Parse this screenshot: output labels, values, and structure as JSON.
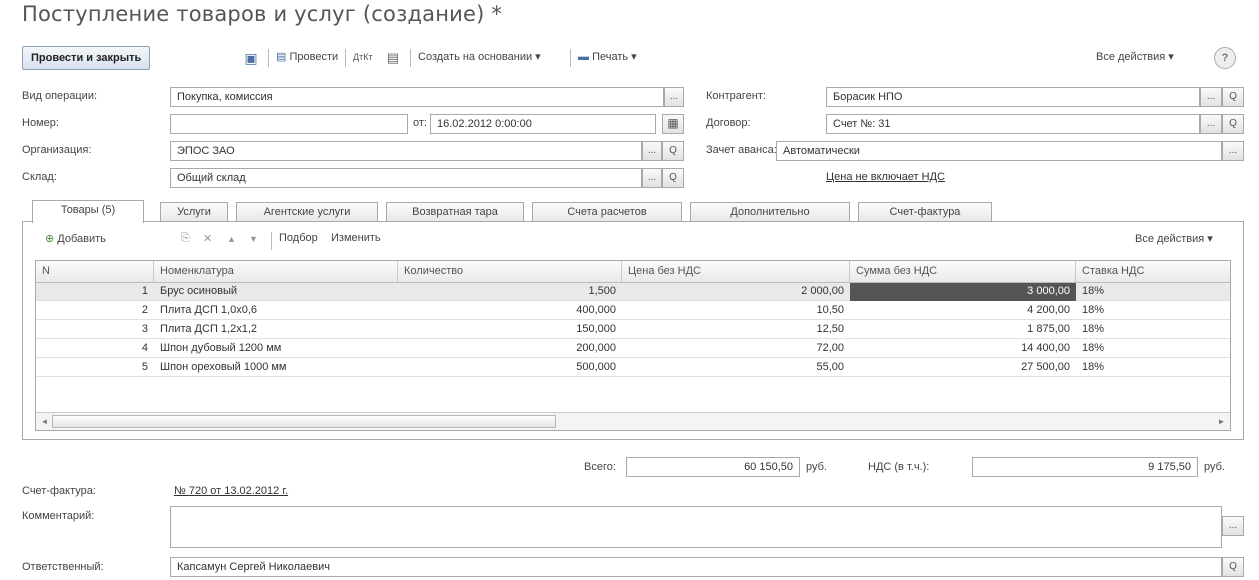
{
  "window": {
    "title": "Поступление товаров и услуг (создание) *"
  },
  "toolbar": {
    "post_close": "Провести и закрыть",
    "save_glyph": "▣",
    "post": "Провести",
    "dt_glyph": "ДтКт",
    "doc_glyph": "▤",
    "create_based": "Создать на основании ▾",
    "print": "Печать ▾",
    "all_actions": "Все действия ▾",
    "help": "?"
  },
  "form": {
    "op_label": "Вид операции:",
    "op_value": "Покупка, комиссия",
    "num_label": "Номер:",
    "num_value": "",
    "date_label": "от:",
    "date_value": "16.02.2012  0:00:00",
    "org_label": "Организация:",
    "org_value": "ЭПОС ЗАО",
    "wh_label": "Склад:",
    "wh_value": "Общий склад",
    "cp_label": "Контрагент:",
    "cp_value": "Борасик НПО",
    "contract_label": "Договор:",
    "contract_value": "Счет №: 31",
    "advance_label": "Зачет аванса:",
    "advance_value": "Автоматически",
    "price_link": "Цена не включает НДС",
    "ellipsis": "...",
    "search": "Q",
    "calendar": "▦"
  },
  "tabs": [
    "Товары (5)",
    "Услуги",
    "Агентские услуги",
    "Возвратная тара",
    "Счета расчетов",
    "Дополнительно",
    "Счет-фактура"
  ],
  "panel_toolbar": {
    "add": "Добавить",
    "copy": "⎘",
    "delete": "✕",
    "up": "▲",
    "down": "▼",
    "select": "Подбор",
    "edit": "Изменить",
    "all_actions": "Все действия ▾"
  },
  "grid": {
    "columns": [
      "N",
      "Номенклатура",
      "Количество",
      "Цена без НДС",
      "Сумма без НДС",
      "Ставка НДС"
    ],
    "rows": [
      {
        "n": "1",
        "name": "Брус осиновый",
        "qty": "1,500",
        "price": "2 000,00",
        "sum": "3 000,00",
        "vat": "18%"
      },
      {
        "n": "2",
        "name": "Плита ДСП 1,0х0,6",
        "qty": "400,000",
        "price": "10,50",
        "sum": "4 200,00",
        "vat": "18%"
      },
      {
        "n": "3",
        "name": "Плита ДСП 1,2х1,2",
        "qty": "150,000",
        "price": "12,50",
        "sum": "1 875,00",
        "vat": "18%"
      },
      {
        "n": "4",
        "name": "Шпон дубовый 1200 мм",
        "qty": "200,000",
        "price": "72,00",
        "sum": "14 400,00",
        "vat": "18%"
      },
      {
        "n": "5",
        "name": "Шпон ореховый 1000 мм",
        "qty": "500,000",
        "price": "55,00",
        "sum": "27 500,00",
        "vat": "18%"
      }
    ],
    "scroll_left": "◄",
    "scroll_right": "►"
  },
  "totals": {
    "total_label": "Всего:",
    "total_value": "60 150,50",
    "currency": "руб.",
    "vat_label": "НДС (в т.ч.):",
    "vat_value": "9 175,50",
    "vat_currency": "руб."
  },
  "footer": {
    "invoice_label": "Счет-фактура:",
    "invoice_link": "№ 720 от 13.02.2012 г.",
    "comment_label": "Комментарий:",
    "comment_value": "",
    "resp_label": "Ответственный:",
    "resp_value": "Капсамун Сергей Николаевич"
  }
}
